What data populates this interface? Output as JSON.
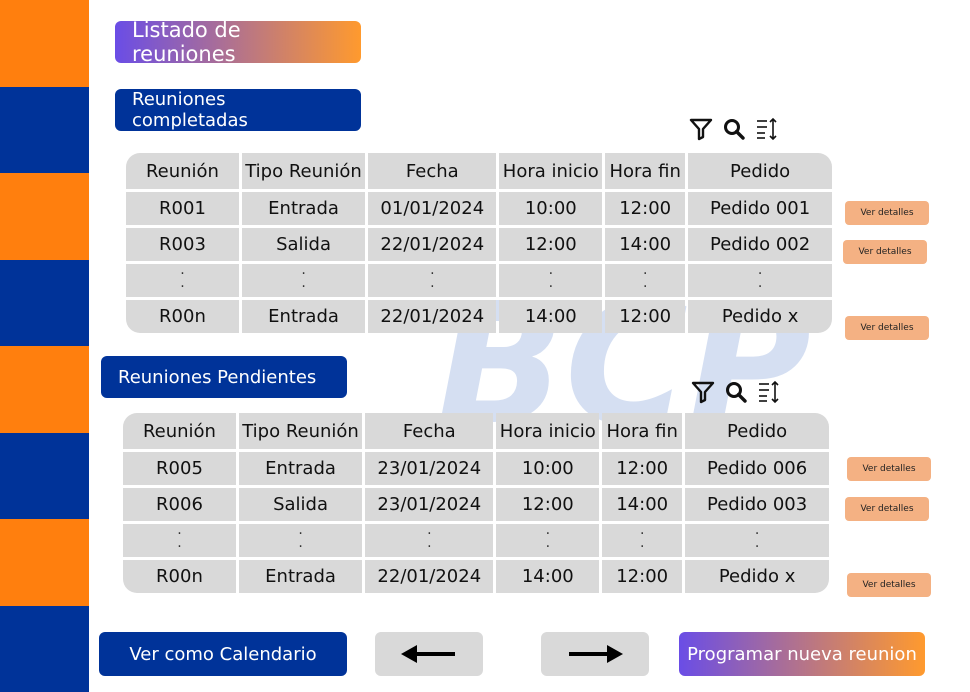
{
  "page": {
    "title": "Listado de reuniones",
    "colors": {
      "orange": "#ff7f0e",
      "navy": "#003399",
      "peach": "#f4b183",
      "cell_gray": "#d9d9d9"
    }
  },
  "watermark": {
    "text": "BCP"
  },
  "toolbar": {
    "icons": [
      "filter-icon",
      "search-icon",
      "sort-icon"
    ]
  },
  "completed": {
    "label": "Reuniones completadas",
    "columns": [
      "Reunión",
      "Tipo Reunión",
      "Fecha",
      "Hora inicio",
      "Hora fin",
      "Pedido"
    ],
    "rows": [
      [
        "R001",
        "Entrada",
        "01/01/2024",
        "10:00",
        "12:00",
        "Pedido 001"
      ],
      [
        "R003",
        "Salida",
        "22/01/2024",
        "12:00",
        "14:00",
        "Pedido 002"
      ],
      [
        "R00n",
        "Entrada",
        "22/01/2024",
        "14:00",
        "12:00",
        "Pedido x"
      ]
    ],
    "details_label": "Ver detalles"
  },
  "pending": {
    "label": "Reuniones Pendientes",
    "columns": [
      "Reunión",
      "Tipo Reunión",
      "Fecha",
      "Hora inicio",
      "Hora fin",
      "Pedido"
    ],
    "rows": [
      [
        "R005",
        "Entrada",
        "23/01/2024",
        "10:00",
        "12:00",
        "Pedido 006"
      ],
      [
        "R006",
        "Salida",
        "23/01/2024",
        "12:00",
        "14:00",
        "Pedido 003"
      ],
      [
        "R00n",
        "Entrada",
        "22/01/2024",
        "14:00",
        "12:00",
        "Pedido x"
      ]
    ],
    "details_label": "Ver detalles"
  },
  "footer": {
    "calendar_label": "Ver como Calendario",
    "prev_icon": "arrow-left-icon",
    "next_icon": "arrow-right-icon",
    "new_label": "Programar nueva reunion"
  }
}
